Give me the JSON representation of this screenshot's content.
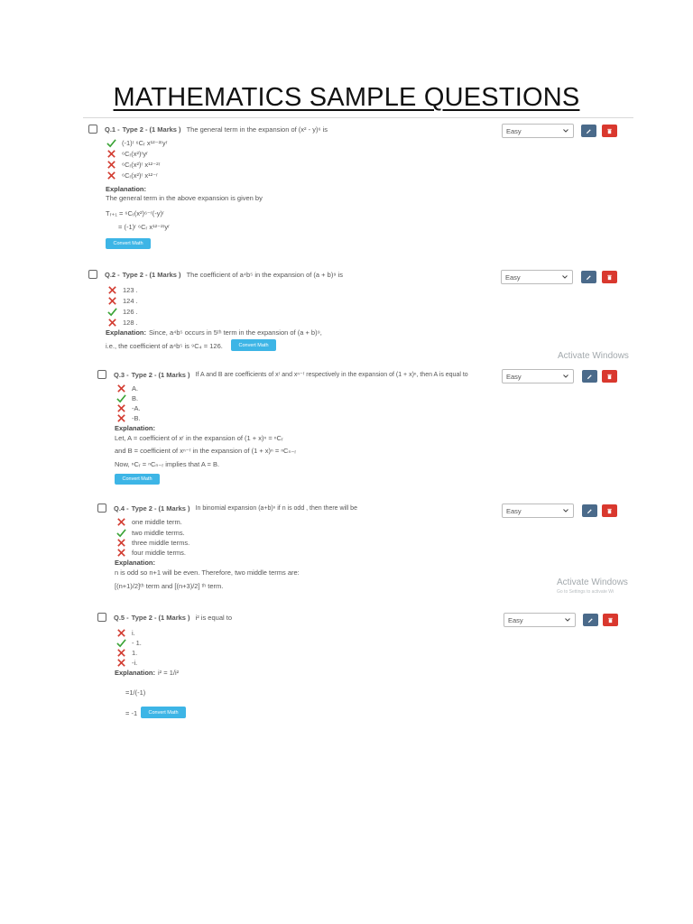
{
  "document": {
    "title": "MATHEMATICS SAMPLE QUESTIONS"
  },
  "colors": {
    "correct": "#39a335",
    "wrong": "#d23a2f",
    "convert": "#3db5e6",
    "edit": "#4a6a8a",
    "delete": "#d9382e"
  },
  "common": {
    "type_label": "Type 2 - (1 Marks )",
    "difficulty": "Easy",
    "convert_label": "Convert Math",
    "explanation_label": "Explanation:",
    "watermark": "Activate Windows",
    "watermark_sub": "Go to Settings to activate Wi"
  },
  "questions": [
    {
      "number": "Q.1 -",
      "text": "The general term in the expansion of (x² - y)⁶ is",
      "options": [
        {
          "text": "(-1)ʳ ⁶Cᵣ x¹²⁻²ʳyʳ",
          "correct": true
        },
        {
          "text": "⁶Cᵣ(x²)ʳyʳ",
          "correct": false
        },
        {
          "text": "⁶Cᵣ(x²)ʳ x¹²⁻²ʳ",
          "correct": false
        },
        {
          "text": "⁶Cᵣ(x²)ʳ x¹²⁻ʳ",
          "correct": false
        }
      ],
      "explanation": [
        "The general term in the above expansion is given by",
        "Tᵣ₊₁ = ⁶Cᵣ(x²)⁶⁻ʳ(-y)ʳ",
        "= (-1)ʳ ⁶Cᵣ x¹²⁻²ʳyʳ"
      ]
    },
    {
      "number": "Q.2 -",
      "text": "The coefficient of a⁴b⁵ in the expansion of (a + b)⁹ is",
      "options": [
        {
          "text": "123 .",
          "correct": false
        },
        {
          "text": "124 .",
          "correct": false
        },
        {
          "text": "126 .",
          "correct": true
        },
        {
          "text": "128 .",
          "correct": false
        }
      ],
      "explanation": [
        "Since, a⁴b⁵ occurs in 5ᵗʰ term in the expansion of (a + b)⁹,",
        "i.e., the coefficient of a⁴b⁵ is ⁹C₄ = 126."
      ]
    },
    {
      "number": "Q.3 -",
      "text": "If A and B are coefficients of xʳ and xⁿ⁻ʳ respectively in the expansion of (1 + x)ⁿ, then A is equal to",
      "options": [
        {
          "text": "A.",
          "correct": false
        },
        {
          "text": "B.",
          "correct": true
        },
        {
          "text": "-A.",
          "correct": false
        },
        {
          "text": "-B.",
          "correct": false
        }
      ],
      "explanation": [
        "Let,      A = coefficient of xʳ in the expansion of (1 + x)ⁿ = ⁿCᵣ",
        "and       B = coefficient of xⁿ⁻ʳ in the expansion of (1 + x)ⁿ = ⁿCₙ₋ᵣ",
        "Now, ⁿCᵣ = ⁿCₙ₋ᵣ implies that A = B."
      ]
    },
    {
      "number": "Q.4 -",
      "text": "In binomial expansion (a+b)ⁿ  if n is odd , then there will be",
      "options": [
        {
          "text": "one middle term.",
          "correct": false
        },
        {
          "text": "two middle terms.",
          "correct": true
        },
        {
          "text": "three middle terms.",
          "correct": false
        },
        {
          "text": "four middle terms.",
          "correct": false
        }
      ],
      "explanation": [
        "n is odd so n+1 will be even. Therefore, two middle terms are:",
        "[(n+1)/2]ᵗʰ term and [(n+3)/2] ᵗʰ term."
      ]
    },
    {
      "number": "Q.5 -",
      "text": "i² is equal to",
      "options": [
        {
          "text": "i.",
          "correct": false
        },
        {
          "text": "- 1.",
          "correct": true
        },
        {
          "text": "1.",
          "correct": false
        },
        {
          "text": "-i.",
          "correct": false
        }
      ],
      "explanation": [
        "i² = 1/i²",
        "=1/(-1)",
        "= -1"
      ]
    }
  ]
}
